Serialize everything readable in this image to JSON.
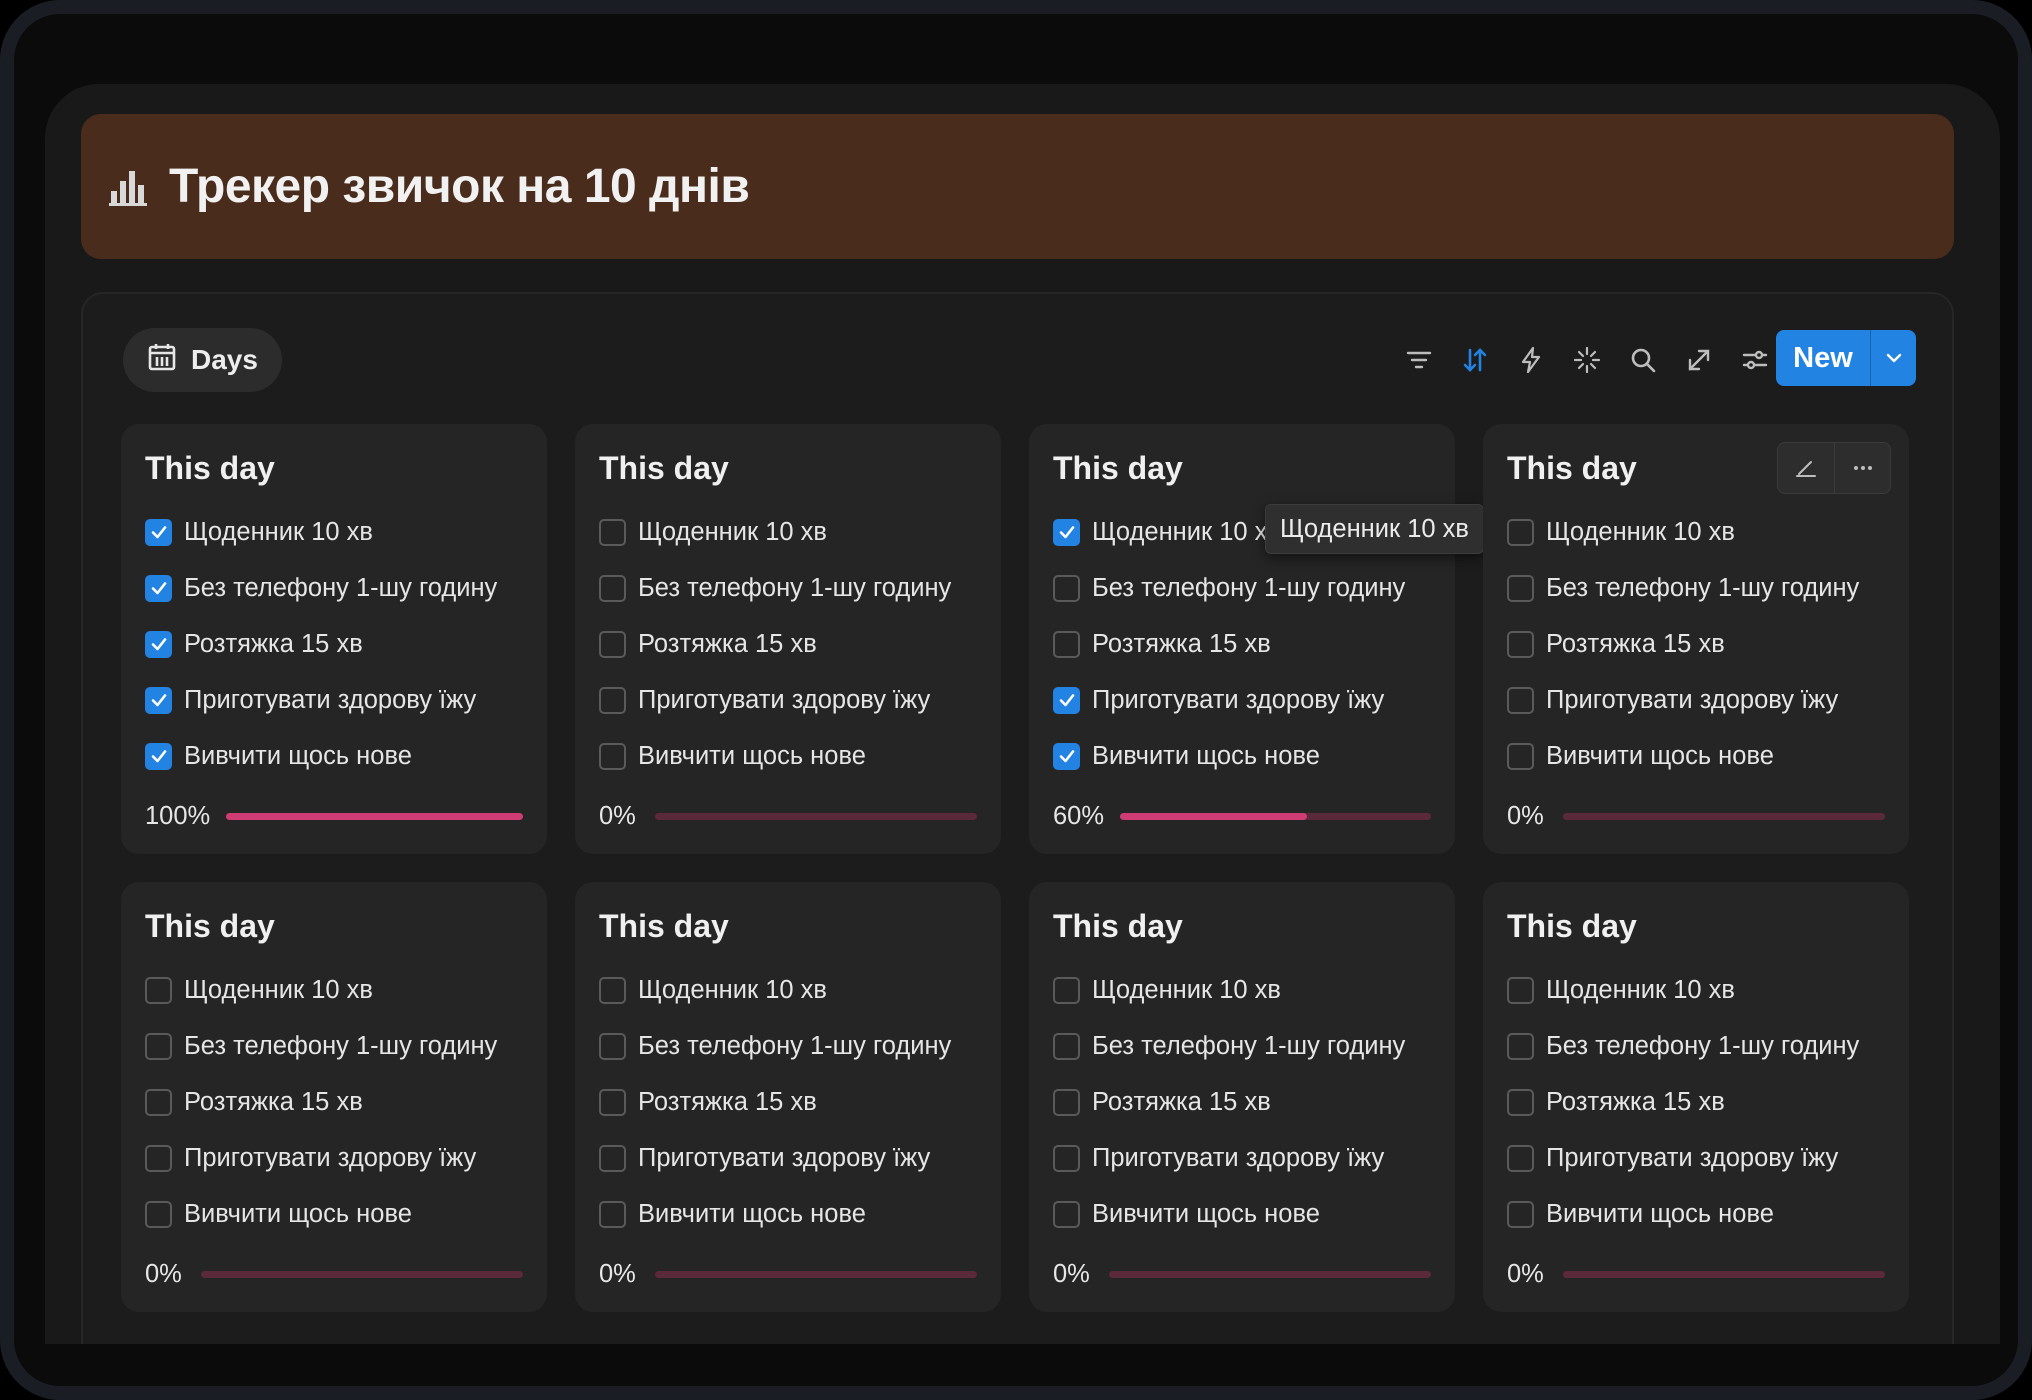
{
  "page": {
    "title": "Трекер звичок на 10 днів",
    "icon": "bar-chart-icon"
  },
  "toolbar": {
    "view_label": "Days",
    "view_icon": "calendar-icon",
    "tools": [
      "filter-icon",
      "sort-icon",
      "lightning-icon",
      "sparkle-icon",
      "search-icon",
      "expand-icon",
      "settings-sliders-icon"
    ],
    "new_label": "New"
  },
  "colors": {
    "accent": "#2383e2",
    "banner": "#4a2c1c",
    "progress_fill": "#cf3c74",
    "progress_track": "#5a2a3a"
  },
  "cards": [
    {
      "title": "This day",
      "habits": [
        {
          "label": "Щоденник 10 хв",
          "checked": true
        },
        {
          "label": "Без телефону 1-шу годину",
          "checked": true
        },
        {
          "label": "Розтяжка 15 хв",
          "checked": true
        },
        {
          "label": "Приготувати здорову їжу",
          "checked": true
        },
        {
          "label": "Вивчити щось нове",
          "checked": true
        }
      ],
      "progress_label": "100%",
      "progress": 1.0
    },
    {
      "title": "This day",
      "habits": [
        {
          "label": "Щоденник 10 хв",
          "checked": false
        },
        {
          "label": "Без телефону 1-шу годину",
          "checked": false
        },
        {
          "label": "Розтяжка 15 хв",
          "checked": false
        },
        {
          "label": "Приготувати здорову їжу",
          "checked": false
        },
        {
          "label": "Вивчити щось нове",
          "checked": false
        }
      ],
      "progress_label": "0%",
      "progress": 0
    },
    {
      "title": "This day",
      "habits": [
        {
          "label": "Щоденник 10 хв",
          "checked": true
        },
        {
          "label": "Без телефону 1-шу годину",
          "checked": false
        },
        {
          "label": "Розтяжка 15 хв",
          "checked": false
        },
        {
          "label": "Приготувати здорову їжу",
          "checked": true
        },
        {
          "label": "Вивчити щось нове",
          "checked": true
        }
      ],
      "progress_label": "60%",
      "progress": 0.6,
      "tooltip": "Щоденник 10 хв"
    },
    {
      "title": "This day",
      "habits": [
        {
          "label": "Щоденник 10 хв",
          "checked": false
        },
        {
          "label": "Без телефону 1-шу годину",
          "checked": false
        },
        {
          "label": "Розтяжка 15 хв",
          "checked": false
        },
        {
          "label": "Приготувати здорову їжу",
          "checked": false
        },
        {
          "label": "Вивчити щось нове",
          "checked": false
        }
      ],
      "progress_label": "0%",
      "progress": 0,
      "hover_actions": [
        "edit-icon",
        "more-icon"
      ]
    },
    {
      "title": "This day",
      "habits": [
        {
          "label": "Щоденник 10 хв",
          "checked": false
        },
        {
          "label": "Без телефону 1-шу годину",
          "checked": false
        },
        {
          "label": "Розтяжка 15 хв",
          "checked": false
        },
        {
          "label": "Приготувати здорову їжу",
          "checked": false
        },
        {
          "label": "Вивчити щось нове",
          "checked": false
        }
      ],
      "progress_label": "0%",
      "progress": 0
    },
    {
      "title": "This day",
      "habits": [
        {
          "label": "Щоденник 10 хв",
          "checked": false
        },
        {
          "label": "Без телефону 1-шу годину",
          "checked": false
        },
        {
          "label": "Розтяжка 15 хв",
          "checked": false
        },
        {
          "label": "Приготувати здорову їжу",
          "checked": false
        },
        {
          "label": "Вивчити щось нове",
          "checked": false
        }
      ],
      "progress_label": "0%",
      "progress": 0
    },
    {
      "title": "This day",
      "habits": [
        {
          "label": "Щоденник 10 хв",
          "checked": false
        },
        {
          "label": "Без телефону 1-шу годину",
          "checked": false
        },
        {
          "label": "Розтяжка 15 хв",
          "checked": false
        },
        {
          "label": "Приготувати здорову їжу",
          "checked": false
        },
        {
          "label": "Вивчити щось нове",
          "checked": false
        }
      ],
      "progress_label": "0%",
      "progress": 0
    },
    {
      "title": "This day",
      "habits": [
        {
          "label": "Щоденник 10 хв",
          "checked": false
        },
        {
          "label": "Без телефону 1-шу годину",
          "checked": false
        },
        {
          "label": "Розтяжка 15 хв",
          "checked": false
        },
        {
          "label": "Приготувати здорову їжу",
          "checked": false
        },
        {
          "label": "Вивчити щось нове",
          "checked": false
        }
      ],
      "progress_label": "0%",
      "progress": 0
    }
  ]
}
